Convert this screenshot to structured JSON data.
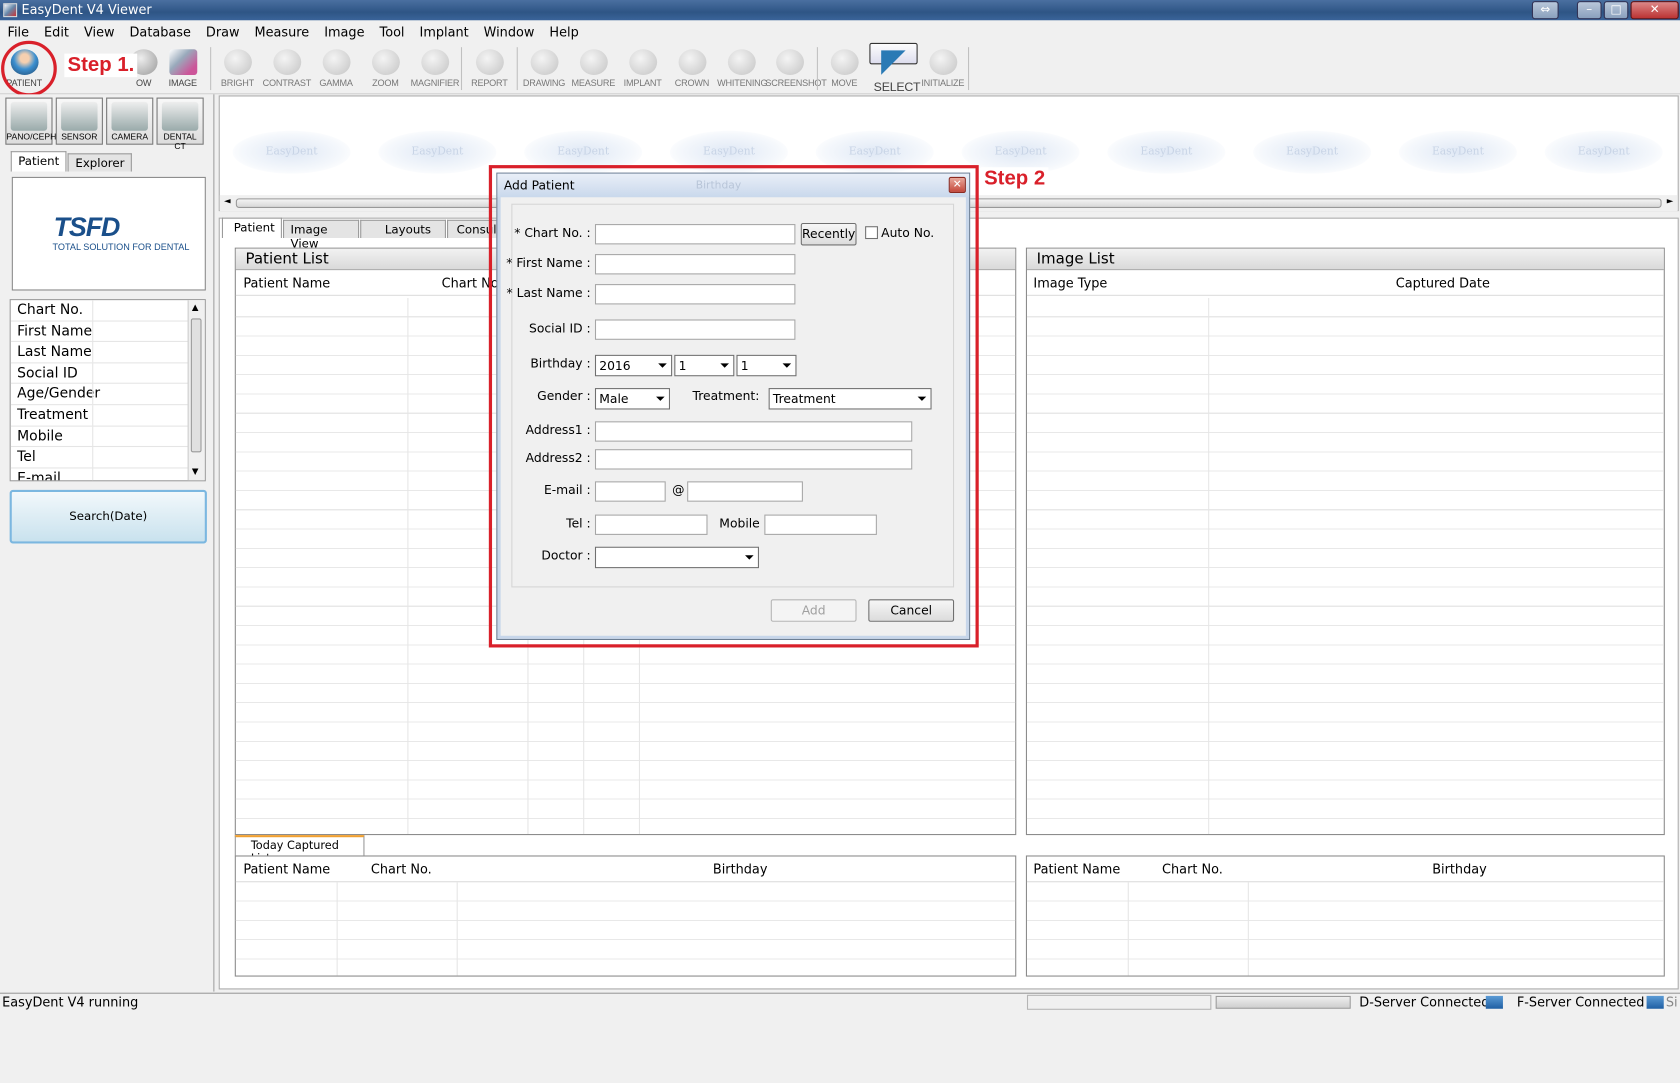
{
  "app": {
    "title": "EasyDent V4 Viewer"
  },
  "menu": [
    "File",
    "Edit",
    "View",
    "Database",
    "Draw",
    "Measure",
    "Image",
    "Tool",
    "Implant",
    "Window",
    "Help"
  ],
  "toolbar": {
    "patient": "PATIENT",
    "ow": "OW",
    "image": "IMAGE",
    "bright": "BRIGHT",
    "contrast": "CONTRAST",
    "gamma": "GAMMA",
    "zoom": "ZOOM",
    "magnifier": "MAGNIFIER",
    "report": "REPORT",
    "drawing": "DRAWING",
    "measure": "MEASURE",
    "implant": "IMPLANT",
    "crown": "CROWN",
    "whitening": "WHITENING",
    "screenshot": "SCREENSHOT",
    "move": "MOVE",
    "select": "SELECT",
    "initialize": "INITIALIZE"
  },
  "annotations": {
    "step1": "Step 1.",
    "step2": "Step 2"
  },
  "devices": [
    "PANO/CEPH",
    "SENSOR",
    "CAMERA",
    "DENTAL CT"
  ],
  "left_tabs": [
    "Patient",
    "Explorer"
  ],
  "logo": {
    "brand": "TSFD",
    "tagline": "TOTAL SOLUTION FOR DENTAL"
  },
  "search_fields": [
    "Chart No.",
    "First Name",
    "Last Name",
    "Social ID",
    "Age/Gender",
    "Treatment",
    "Mobile",
    "Tel",
    "E-mail"
  ],
  "search_button": "Search(Date)",
  "watermark": "EasyDent",
  "main_tabs": [
    "Patient",
    "Image View",
    "Layouts",
    "Consulta"
  ],
  "patient_list": {
    "title": "Patient List",
    "columns": [
      "Patient Name",
      "Chart No"
    ]
  },
  "image_list": {
    "title": "Image List",
    "columns": [
      "Image Type",
      "Captured Date"
    ]
  },
  "today_tab": "Today Captured List",
  "today_list": {
    "columns": [
      "Patient Name",
      "Chart No.",
      "Birthday"
    ]
  },
  "right_bottom_list": {
    "columns": [
      "Patient Name",
      "Chart No.",
      "Birthday"
    ]
  },
  "dialog": {
    "title": "Add Patient",
    "ghost": "Birthday",
    "chart_no_label": "* Chart No. :",
    "recently_button": "Recently",
    "auto_no_label": "Auto No.",
    "first_name_label": "* First Name :",
    "last_name_label": "* Last Name :",
    "social_id_label": "Social ID :",
    "birthday_label": "Birthday :",
    "birthday_year": "2016",
    "birthday_month": "1",
    "birthday_day": "1",
    "gender_label": "Gender :",
    "gender_value": "Male",
    "treatment_label": "Treatment:",
    "treatment_value": "Treatment",
    "address1_label": "Address1 :",
    "address2_label": "Address2 :",
    "email_label": "E-mail :",
    "at": "@",
    "tel_label": "Tel :",
    "mobile_label": "Mobile :",
    "doctor_label": "Doctor :",
    "doctor_value": "",
    "add_button": "Add",
    "cancel_button": "Cancel"
  },
  "status": {
    "text": "EasyDent V4 running",
    "dserver": "D-Server Connected",
    "fserver": "F-Server Connected",
    "si": "Si"
  },
  "colors": {
    "highlight": "#d9202a",
    "accent": "#1a4f8a"
  }
}
